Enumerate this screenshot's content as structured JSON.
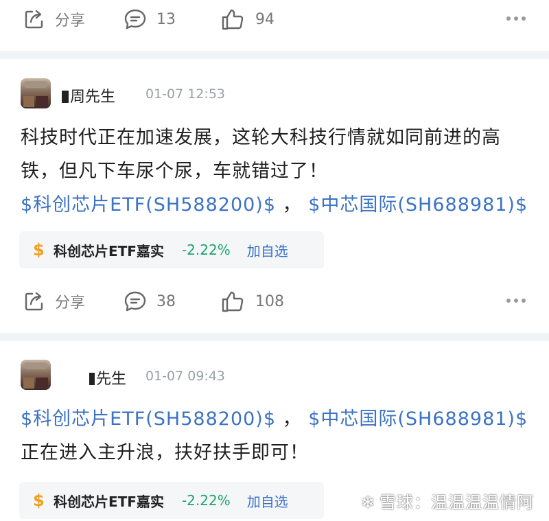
{
  "post1_actions": {
    "share_label": "分享",
    "comments": "13",
    "likes": "94"
  },
  "post2": {
    "author": "周先生",
    "time": "01-07 12:53",
    "text_line1": "科技时代正在加速发展，这轮大科技行情就如同前进的高",
    "text_line2": "铁，但凡下车尿个尿，车就错过了！",
    "link1": "$科创芯片ETF(SH588200)$",
    "sep": " ， ",
    "link2": "$中芯国际(SH688981)$",
    "stock": {
      "symbol": "$",
      "name": "科创芯片ETF嘉实",
      "change": "-2.22%",
      "add": "加自选"
    },
    "actions": {
      "share_label": "分享",
      "comments": "38",
      "likes": "108"
    }
  },
  "post3": {
    "author": "先生",
    "time": "01-07 09:43",
    "link1": "$科创芯片ETF(SH588200)$",
    "sep": " ， ",
    "link2": "$中芯国际(SH688981)$",
    "text_line": "正在进入主升浪，扶好扶手即可！",
    "stock": {
      "symbol": "$",
      "name": "科创芯片ETF嘉实",
      "change": "-2.22%",
      "add": "加自选"
    }
  },
  "watermark": "雪球：温温温温情阿",
  "colors": {
    "link": "#3a72c4",
    "down": "#1aa56b",
    "dollar": "#f0a020",
    "divider": "#f2f3f5"
  }
}
